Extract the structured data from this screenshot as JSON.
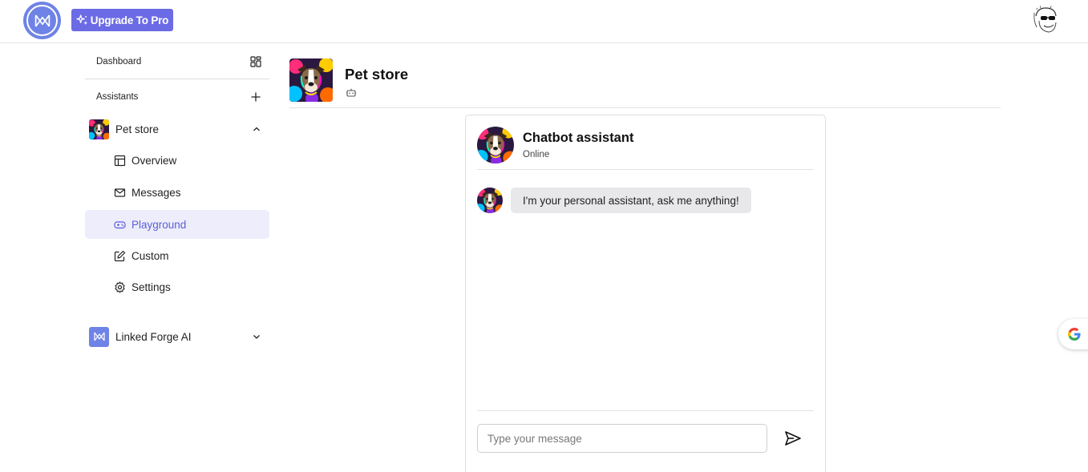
{
  "topbar": {
    "upgrade_label": "Upgrade To Pro"
  },
  "sidebar": {
    "dashboard_label": "Dashboard",
    "assistants_label": "Assistants",
    "pet_store_label": "Pet store",
    "sub_items": [
      {
        "label": "Overview",
        "icon": "layout-icon"
      },
      {
        "label": "Messages",
        "icon": "mail-icon"
      },
      {
        "label": "Playground",
        "icon": "gamepad-icon",
        "active": true
      },
      {
        "label": "Custom",
        "icon": "edit-icon"
      },
      {
        "label": "Settings",
        "icon": "gear-icon"
      }
    ],
    "linked_forge_label": "Linked Forge AI"
  },
  "main": {
    "title": "Pet store"
  },
  "chat": {
    "title": "Chatbot assistant",
    "status": "Online",
    "messages": [
      {
        "from": "assistant",
        "text": "I'm your personal assistant, ask me anything!"
      }
    ],
    "input_placeholder": "Type your message"
  },
  "colors": {
    "accent": "#6b6be6",
    "active_bg": "#ededfb",
    "active_text": "#5b5fd6",
    "logo": "#6f83e6"
  }
}
